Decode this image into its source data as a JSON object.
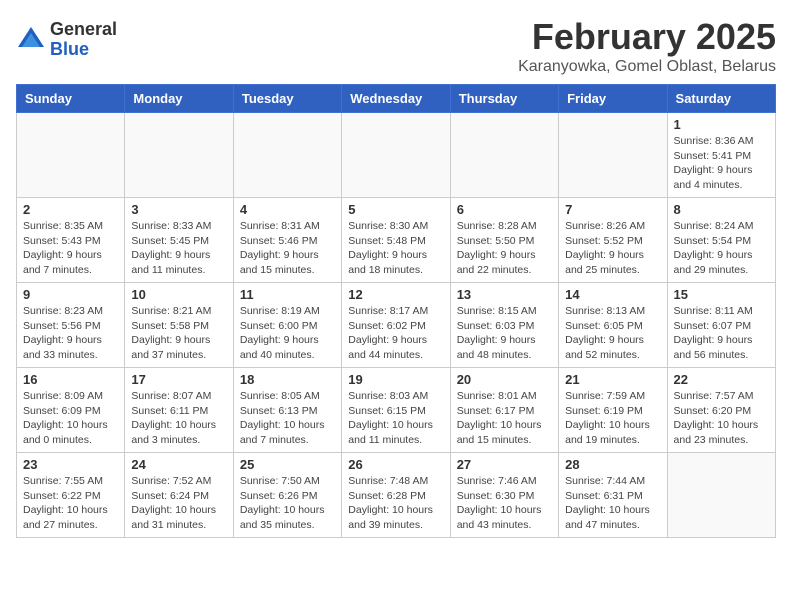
{
  "header": {
    "logo_general": "General",
    "logo_blue": "Blue",
    "month_title": "February 2025",
    "location": "Karanyowka, Gomel Oblast, Belarus"
  },
  "weekdays": [
    "Sunday",
    "Monday",
    "Tuesday",
    "Wednesday",
    "Thursday",
    "Friday",
    "Saturday"
  ],
  "weeks": [
    [
      {
        "day": "",
        "info": ""
      },
      {
        "day": "",
        "info": ""
      },
      {
        "day": "",
        "info": ""
      },
      {
        "day": "",
        "info": ""
      },
      {
        "day": "",
        "info": ""
      },
      {
        "day": "",
        "info": ""
      },
      {
        "day": "1",
        "info": "Sunrise: 8:36 AM\nSunset: 5:41 PM\nDaylight: 9 hours and 4 minutes."
      }
    ],
    [
      {
        "day": "2",
        "info": "Sunrise: 8:35 AM\nSunset: 5:43 PM\nDaylight: 9 hours and 7 minutes."
      },
      {
        "day": "3",
        "info": "Sunrise: 8:33 AM\nSunset: 5:45 PM\nDaylight: 9 hours and 11 minutes."
      },
      {
        "day": "4",
        "info": "Sunrise: 8:31 AM\nSunset: 5:46 PM\nDaylight: 9 hours and 15 minutes."
      },
      {
        "day": "5",
        "info": "Sunrise: 8:30 AM\nSunset: 5:48 PM\nDaylight: 9 hours and 18 minutes."
      },
      {
        "day": "6",
        "info": "Sunrise: 8:28 AM\nSunset: 5:50 PM\nDaylight: 9 hours and 22 minutes."
      },
      {
        "day": "7",
        "info": "Sunrise: 8:26 AM\nSunset: 5:52 PM\nDaylight: 9 hours and 25 minutes."
      },
      {
        "day": "8",
        "info": "Sunrise: 8:24 AM\nSunset: 5:54 PM\nDaylight: 9 hours and 29 minutes."
      }
    ],
    [
      {
        "day": "9",
        "info": "Sunrise: 8:23 AM\nSunset: 5:56 PM\nDaylight: 9 hours and 33 minutes."
      },
      {
        "day": "10",
        "info": "Sunrise: 8:21 AM\nSunset: 5:58 PM\nDaylight: 9 hours and 37 minutes."
      },
      {
        "day": "11",
        "info": "Sunrise: 8:19 AM\nSunset: 6:00 PM\nDaylight: 9 hours and 40 minutes."
      },
      {
        "day": "12",
        "info": "Sunrise: 8:17 AM\nSunset: 6:02 PM\nDaylight: 9 hours and 44 minutes."
      },
      {
        "day": "13",
        "info": "Sunrise: 8:15 AM\nSunset: 6:03 PM\nDaylight: 9 hours and 48 minutes."
      },
      {
        "day": "14",
        "info": "Sunrise: 8:13 AM\nSunset: 6:05 PM\nDaylight: 9 hours and 52 minutes."
      },
      {
        "day": "15",
        "info": "Sunrise: 8:11 AM\nSunset: 6:07 PM\nDaylight: 9 hours and 56 minutes."
      }
    ],
    [
      {
        "day": "16",
        "info": "Sunrise: 8:09 AM\nSunset: 6:09 PM\nDaylight: 10 hours and 0 minutes."
      },
      {
        "day": "17",
        "info": "Sunrise: 8:07 AM\nSunset: 6:11 PM\nDaylight: 10 hours and 3 minutes."
      },
      {
        "day": "18",
        "info": "Sunrise: 8:05 AM\nSunset: 6:13 PM\nDaylight: 10 hours and 7 minutes."
      },
      {
        "day": "19",
        "info": "Sunrise: 8:03 AM\nSunset: 6:15 PM\nDaylight: 10 hours and 11 minutes."
      },
      {
        "day": "20",
        "info": "Sunrise: 8:01 AM\nSunset: 6:17 PM\nDaylight: 10 hours and 15 minutes."
      },
      {
        "day": "21",
        "info": "Sunrise: 7:59 AM\nSunset: 6:19 PM\nDaylight: 10 hours and 19 minutes."
      },
      {
        "day": "22",
        "info": "Sunrise: 7:57 AM\nSunset: 6:20 PM\nDaylight: 10 hours and 23 minutes."
      }
    ],
    [
      {
        "day": "23",
        "info": "Sunrise: 7:55 AM\nSunset: 6:22 PM\nDaylight: 10 hours and 27 minutes."
      },
      {
        "day": "24",
        "info": "Sunrise: 7:52 AM\nSunset: 6:24 PM\nDaylight: 10 hours and 31 minutes."
      },
      {
        "day": "25",
        "info": "Sunrise: 7:50 AM\nSunset: 6:26 PM\nDaylight: 10 hours and 35 minutes."
      },
      {
        "day": "26",
        "info": "Sunrise: 7:48 AM\nSunset: 6:28 PM\nDaylight: 10 hours and 39 minutes."
      },
      {
        "day": "27",
        "info": "Sunrise: 7:46 AM\nSunset: 6:30 PM\nDaylight: 10 hours and 43 minutes."
      },
      {
        "day": "28",
        "info": "Sunrise: 7:44 AM\nSunset: 6:31 PM\nDaylight: 10 hours and 47 minutes."
      },
      {
        "day": "",
        "info": ""
      }
    ]
  ]
}
